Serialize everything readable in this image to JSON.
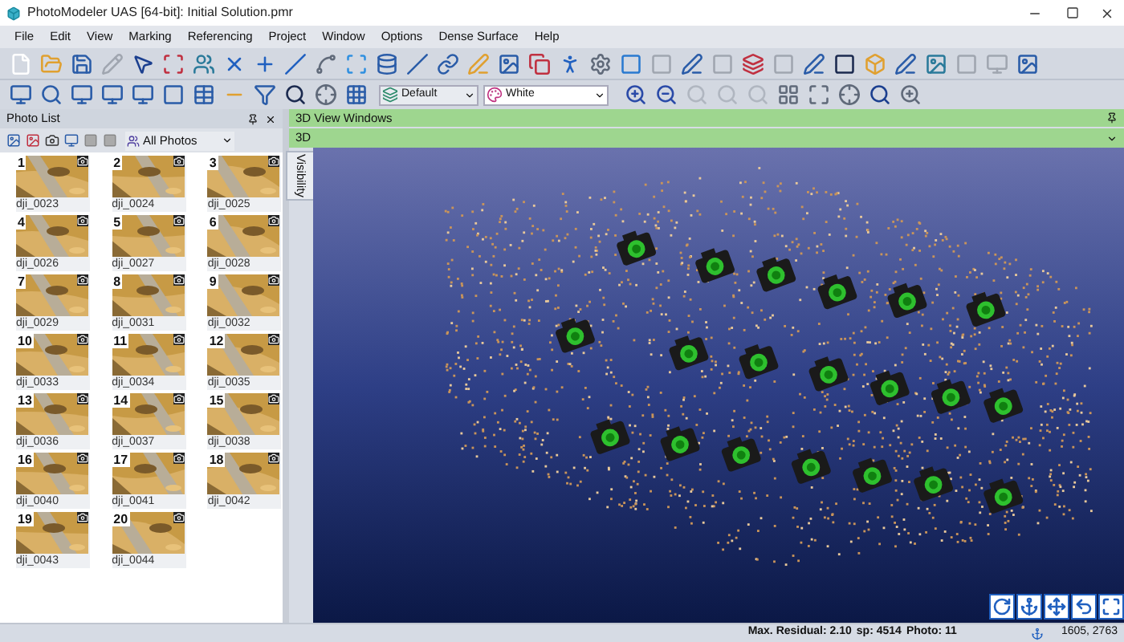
{
  "window": {
    "title": "PhotoModeler UAS [64-bit]: Initial Solution.pmr"
  },
  "menu": [
    "File",
    "Edit",
    "View",
    "Marking",
    "Referencing",
    "Project",
    "Window",
    "Options",
    "Dense Surface",
    "Help"
  ],
  "toolbar": {
    "layer_select": "Default",
    "color_select": "White"
  },
  "photo_list": {
    "title": "Photo List",
    "filter": "All Photos",
    "photos": [
      {
        "number": "1",
        "name": "dji_0023"
      },
      {
        "number": "2",
        "name": "dji_0024"
      },
      {
        "number": "3",
        "name": "dji_0025"
      },
      {
        "number": "4",
        "name": "dji_0026"
      },
      {
        "number": "5",
        "name": "dji_0027"
      },
      {
        "number": "6",
        "name": "dji_0028"
      },
      {
        "number": "7",
        "name": "dji_0029"
      },
      {
        "number": "8",
        "name": "dji_0031"
      },
      {
        "number": "9",
        "name": "dji_0032"
      },
      {
        "number": "10",
        "name": "dji_0033"
      },
      {
        "number": "11",
        "name": "dji_0034"
      },
      {
        "number": "12",
        "name": "dji_0035"
      },
      {
        "number": "13",
        "name": "dji_0036"
      },
      {
        "number": "14",
        "name": "dji_0037"
      },
      {
        "number": "15",
        "name": "dji_0038"
      },
      {
        "number": "16",
        "name": "dji_0040"
      },
      {
        "number": "17",
        "name": "dji_0041"
      },
      {
        "number": "18",
        "name": "dji_0042"
      },
      {
        "number": "19",
        "name": "dji_0043"
      },
      {
        "number": "20",
        "name": "dji_0044"
      }
    ]
  },
  "view_windows": {
    "title": "3D View Windows",
    "tab": "3D",
    "side_tab": "Visibility"
  },
  "status_bar": {
    "residual": "Max. Residual: 2.10",
    "sp": "sp: 4514",
    "photo": "Photo: 11",
    "coords": "1605, 2763"
  }
}
